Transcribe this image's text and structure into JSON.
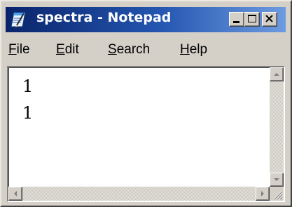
{
  "window": {
    "title": "spectra - Notepad",
    "app_icon": "notepad-icon",
    "controls": {
      "minimize_icon": "minimize-icon",
      "maximize_icon": "maximize-icon",
      "close_icon": "close-icon"
    }
  },
  "menubar": {
    "items": [
      {
        "accel": "F",
        "rest": "ile"
      },
      {
        "accel": "E",
        "rest": "dit"
      },
      {
        "accel": "S",
        "rest": "earch"
      },
      {
        "accel": "H",
        "rest": "elp"
      }
    ]
  },
  "editor": {
    "lines": [
      "1",
      "1"
    ]
  },
  "colors": {
    "titlebar_start": "#0a246a",
    "titlebar_end": "#6d9be0",
    "chrome": "#d4d0c8",
    "editor_bg": "#ffffff"
  }
}
